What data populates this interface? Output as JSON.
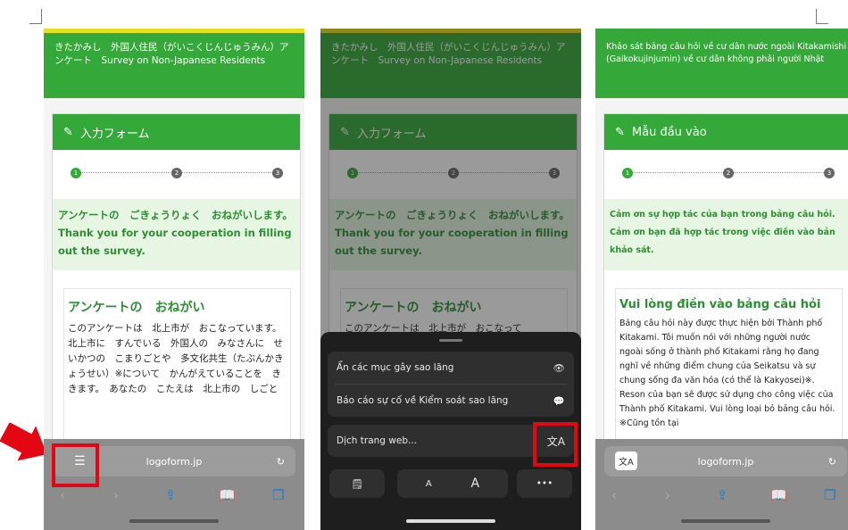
{
  "screen1": {
    "header": "きたかみし　外国人住民（がいこくじんじゅうみん）アンケート　Survey on Non-Japanese Residents",
    "form_title": "入力フォーム",
    "steps": [
      "1",
      "2",
      "3"
    ],
    "thanks_jp": "アンケートの　ごきょうりょく　おねがいします。",
    "thanks_en": "Thank you for your cooperation in filling out the survey.",
    "notice_title": "アンケートの　おねがい",
    "notice_body": "このアンケートは　北上市が　おこなっています。北上市に　すんでいる　外国人の　みなさんに　せいかつの　こまりごとや　多文化共生（たぶんかきょうせい）※について　かんがえていることを　ききます。　あなたの　こたえは　北上市の　しごと",
    "url": "logoform.jp"
  },
  "screen2": {
    "header": "きたかみし　外国人住民（がいこくじんじゅうみん）アンケート　Survey on Non-Japanese Residents",
    "form_title": "入力フォーム",
    "thanks_jp": "アンケートの　ごきょうりょく　おねがいします。",
    "thanks_en": "Thank you for your cooperation in filling out the survey.",
    "notice_title": "アンケートの　おねがい",
    "notice_body": "このアンケートは　北上市が　おこなって",
    "menu": {
      "hide": "Ẩn các mục gây sao lãng",
      "report": "Báo cáo sự cố về Kiểm soát sao lãng",
      "translate": "Dịch trang web...",
      "small_a": "A",
      "big_a": "A",
      "more": "•••"
    }
  },
  "screen3": {
    "header": "Khảo sát bảng câu hỏi về cư dân nước ngoài Kitakamishi (Gaikokujinjumin) về cư dân không phải người Nhật",
    "form_title": "Mẫu đầu vào",
    "thanks": "Cảm ơn sự hợp tác của bạn trong bảng câu hỏi. Cảm ơn bạn đã hợp tác trong việc điền vào bản khảo sát.",
    "notice_title": "Vui lòng điền vào bảng câu hỏi",
    "notice_body": "Bảng câu hỏi này được thực hiện bởi Thành phố Kitakami. Tôi muốn nói với những người nước ngoài sống ở thành phố Kitakami rằng họ đang nghĩ về những điểm chung của Seikatsu và sự chung sống đa văn hóa (có thể là Kakyosei)※. Reson của bạn sẽ được sử dụng cho công việc của Thành phố Kitakami. Vui lòng loại bỏ bảng câu hỏi. ※Cũng tồn tại",
    "url": "logoform.jp"
  },
  "colors": {
    "green": "#35a83a",
    "highlight": "#e30613"
  },
  "icons": [
    "edit-icon",
    "reader-icon",
    "reload-icon",
    "back-icon",
    "forward-icon",
    "share-icon",
    "bookmarks-icon",
    "tabs-icon",
    "eye-icon",
    "report-icon",
    "translate-icon",
    "reader-page-icon"
  ]
}
